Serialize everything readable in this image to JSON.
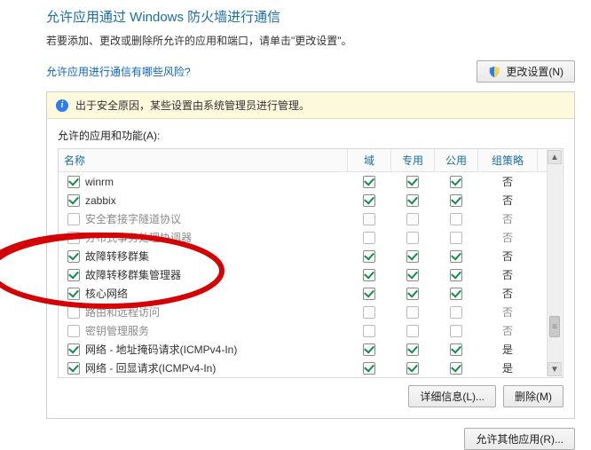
{
  "title": "允许应用通过 Windows 防火墙进行通信",
  "subtitle": "若要添加、更改或删除所允许的应用和端口，请单击\"更改设置\"。",
  "risk_link": "允许应用进行通信有哪些风险?",
  "change_settings_btn": "更改设置(N)",
  "notice": "出于安全原因，某些设置由系统管理员进行管理。",
  "section_label": "允许的应用和功能(A):",
  "columns": {
    "name": "名称",
    "domain": "域",
    "private": "专用",
    "public": "公用",
    "group": "组策略"
  },
  "rows": [
    {
      "enabled": true,
      "label": "winrm",
      "d": true,
      "p": true,
      "pu": true,
      "g": "否",
      "dim": false
    },
    {
      "enabled": true,
      "label": "zabbix",
      "d": true,
      "p": true,
      "pu": true,
      "g": "否",
      "dim": false
    },
    {
      "enabled": false,
      "label": "安全套接字隧道协议",
      "d": false,
      "p": false,
      "pu": false,
      "g": "否",
      "dim": true
    },
    {
      "enabled": false,
      "label": "分布式事务处理协调器",
      "d": false,
      "p": false,
      "pu": false,
      "g": "否",
      "dim": true
    },
    {
      "enabled": true,
      "label": "故障转移群集",
      "d": true,
      "p": true,
      "pu": true,
      "g": "否",
      "dim": false
    },
    {
      "enabled": true,
      "label": "故障转移群集管理器",
      "d": true,
      "p": true,
      "pu": true,
      "g": "否",
      "dim": false
    },
    {
      "enabled": true,
      "label": "核心网络",
      "d": true,
      "p": true,
      "pu": true,
      "g": "否",
      "dim": false
    },
    {
      "enabled": false,
      "label": "路由和远程访问",
      "d": false,
      "p": false,
      "pu": false,
      "g": "否",
      "dim": true
    },
    {
      "enabled": false,
      "label": "密钥管理服务",
      "d": false,
      "p": false,
      "pu": false,
      "g": "否",
      "dim": true
    },
    {
      "enabled": true,
      "label": "网络 - 地址掩码请求(ICMPv4-In)",
      "d": true,
      "p": true,
      "pu": true,
      "g": "是",
      "dim": false
    },
    {
      "enabled": true,
      "label": "网络 - 回显请求(ICMPv4-In)",
      "d": true,
      "p": true,
      "pu": true,
      "g": "是",
      "dim": false
    }
  ],
  "details_btn": "详细信息(L)...",
  "remove_btn": "删除(M)",
  "allow_other_btn": "允许其他应用(R)..."
}
